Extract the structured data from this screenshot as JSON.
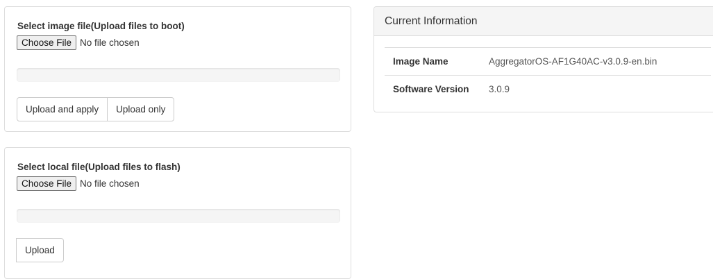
{
  "boot_panel": {
    "label": "Select image file(Upload files to boot)",
    "choose_file": "Choose File",
    "file_status": "No file chosen",
    "progress": 0,
    "upload_apply": "Upload and apply",
    "upload_only": "Upload only"
  },
  "flash_panel": {
    "label": "Select local file(Upload files to flash)",
    "choose_file": "Choose File",
    "file_status": "No file chosen",
    "progress": 0,
    "upload": "Upload"
  },
  "info_panel": {
    "title": "Current Information",
    "rows": [
      {
        "key": "Image Name",
        "value": "AggregatorOS-AF1G40AC-v3.0.9-en.bin"
      },
      {
        "key": "Software Version",
        "value": "3.0.9"
      }
    ]
  },
  "colors": {
    "border": "#dddddd",
    "heading_bg": "#f5f5f5",
    "progress_track": "#f5f5f5",
    "progress_fill": "#337ab7"
  }
}
